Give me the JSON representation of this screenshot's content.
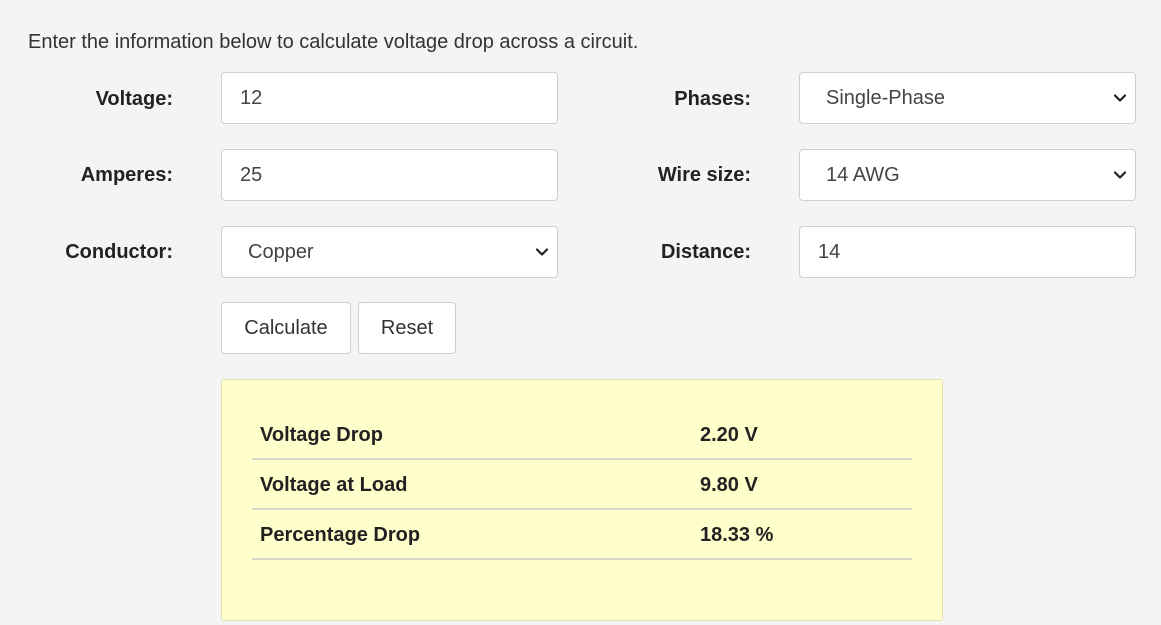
{
  "intro": "Enter the information below to calculate voltage drop across a circuit.",
  "form": {
    "voltage": {
      "label": "Voltage:",
      "value": "12"
    },
    "amperes": {
      "label": "Amperes:",
      "value": "25"
    },
    "conductor": {
      "label": "Conductor:",
      "value": "Copper"
    },
    "phases": {
      "label": "Phases:",
      "value": "Single-Phase"
    },
    "wire_size": {
      "label": "Wire size:",
      "value": "14 AWG"
    },
    "distance": {
      "label": "Distance:",
      "value": "14"
    }
  },
  "buttons": {
    "calculate": "Calculate",
    "reset": "Reset"
  },
  "results": [
    {
      "label": "Voltage Drop",
      "value": "2.20 V"
    },
    {
      "label": "Voltage at Load",
      "value": "9.80 V"
    },
    {
      "label": "Percentage Drop",
      "value": "18.33 %"
    }
  ],
  "colors": {
    "background": "#f4f4f4",
    "result_panel": "#ffffcc"
  },
  "icons": {
    "select_arrow": "chevron-down-icon"
  }
}
